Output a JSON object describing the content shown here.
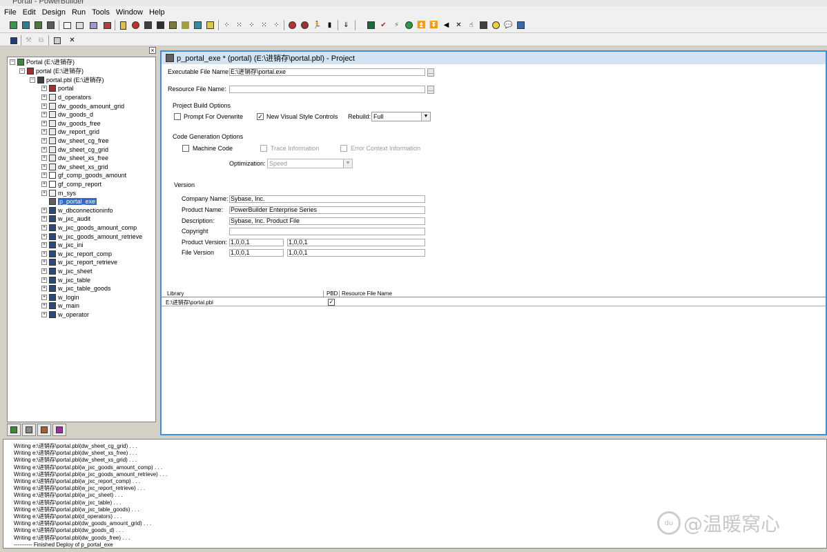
{
  "window": {
    "title": "Portal - PowerBuilder"
  },
  "menu": [
    "File",
    "Edit",
    "Design",
    "Run",
    "Tools",
    "Window",
    "Help"
  ],
  "tree": {
    "nodes": [
      {
        "label": "Portal (E:\\进销存)"
      },
      {
        "label": "portal (E:\\进销存)"
      },
      {
        "label": "portal.pbl (E:\\进销存)"
      },
      {
        "label": "portal"
      },
      {
        "label": "d_operators"
      },
      {
        "label": "dw_goods_amount_grid"
      },
      {
        "label": "dw_goods_d"
      },
      {
        "label": "dw_goods_free"
      },
      {
        "label": "dw_report_grid"
      },
      {
        "label": "dw_sheet_cg_free"
      },
      {
        "label": "dw_sheet_cg_grid"
      },
      {
        "label": "dw_sheet_xs_free"
      },
      {
        "label": "dw_sheet_xs_grid"
      },
      {
        "label": "gf_comp_goods_amount"
      },
      {
        "label": "gf_comp_report"
      },
      {
        "label": "m_sys"
      },
      {
        "label": "p_portal_exe"
      },
      {
        "label": "w_dbconnectioninfo"
      },
      {
        "label": "w_jxc_audit"
      },
      {
        "label": "w_jxc_goods_amount_comp"
      },
      {
        "label": "w_jxc_goods_amount_retrieve"
      },
      {
        "label": "w_jxc_ini"
      },
      {
        "label": "w_jxc_report_comp"
      },
      {
        "label": "w_jxc_report_retrieve"
      },
      {
        "label": "w_jxc_sheet"
      },
      {
        "label": "w_jxc_table"
      },
      {
        "label": "w_jxc_table_goods"
      },
      {
        "label": "w_login"
      },
      {
        "label": "w_main"
      },
      {
        "label": "w_operator"
      }
    ]
  },
  "project": {
    "title": "p_portal_exe * (portal) (E:\\进销存\\portal.pbl) - Project",
    "exe_label": "Executable File Name:",
    "exe_value": "E:\\进销存\\portal.exe",
    "res_label": "Resource File Name:",
    "res_value": "",
    "dots": "...",
    "build_options": "Project Build Options",
    "prompt_overwrite": "Prompt For Overwrite",
    "new_visual": "New Visual Style Controls",
    "rebuild_label": "Rebuild:",
    "rebuild_value": "Full",
    "codegen": "Code Generation Options",
    "machine_code": "Machine Code",
    "trace_info": "Trace Information",
    "error_context": "Error Context Information",
    "optimization_label": "Optimization:",
    "optimization_value": "Speed",
    "version": "Version",
    "company_label": "Company Name:",
    "company_value": "Sybase, Inc.",
    "product_label": "Product Name:",
    "product_value": "PowerBuilder Enterprise Series",
    "desc_label": "Description:",
    "desc_value": "Sybase, Inc. Product File",
    "copyright_label": "Copyright",
    "copyright_value": "",
    "prodver_label": "Product Version:",
    "prodver_1": "1,0,0,1",
    "prodver_2": "1,0,0,1",
    "filever_label": "File Version",
    "filever_1": "1,0,0,1",
    "filever_2": "1,0,0,1",
    "lib_col": "Library",
    "pbd_col": "PBD",
    "res_col": "Resource File Name",
    "lib_row": "E:\\进销存\\portal.pbl",
    "lib_check": "✓"
  },
  "output": {
    "lines": [
      "Writing e:\\进销存\\portal.pbl(dw_sheet_cg_grid) . . .",
      "Writing e:\\进销存\\portal.pbl(dw_sheet_xs_free) . . .",
      "Writing e:\\进销存\\portal.pbl(dw_sheet_xs_grid) . . .",
      "Writing e:\\进销存\\portal.pbl(w_jxc_goods_amount_comp) . . .",
      "Writing e:\\进销存\\portal.pbl(w_jxc_goods_amount_retrieve) . . .",
      "Writing e:\\进销存\\portal.pbl(w_jxc_report_comp) . . .",
      "Writing e:\\进销存\\portal.pbl(w_jxc_report_retrieve) . . .",
      "Writing e:\\进销存\\portal.pbl(w_jxc_sheet) . . .",
      "Writing e:\\进销存\\portal.pbl(w_jxc_table) . . .",
      "Writing e:\\进销存\\portal.pbl(w_jxc_table_goods) . . .",
      "Writing e:\\进销存\\portal.pbl(d_operators) . . .",
      "Writing e:\\进销存\\portal.pbl(dw_goods_amount_grid) . . .",
      "Writing e:\\进销存\\portal.pbl(dw_goods_d) . . .",
      "Writing e:\\进销存\\portal.pbl(dw_goods_free) . . .",
      "---------- Finished Deploy of p_portal_exe"
    ]
  },
  "watermark": {
    "text": "@温暖窝心",
    "logo": "du"
  }
}
